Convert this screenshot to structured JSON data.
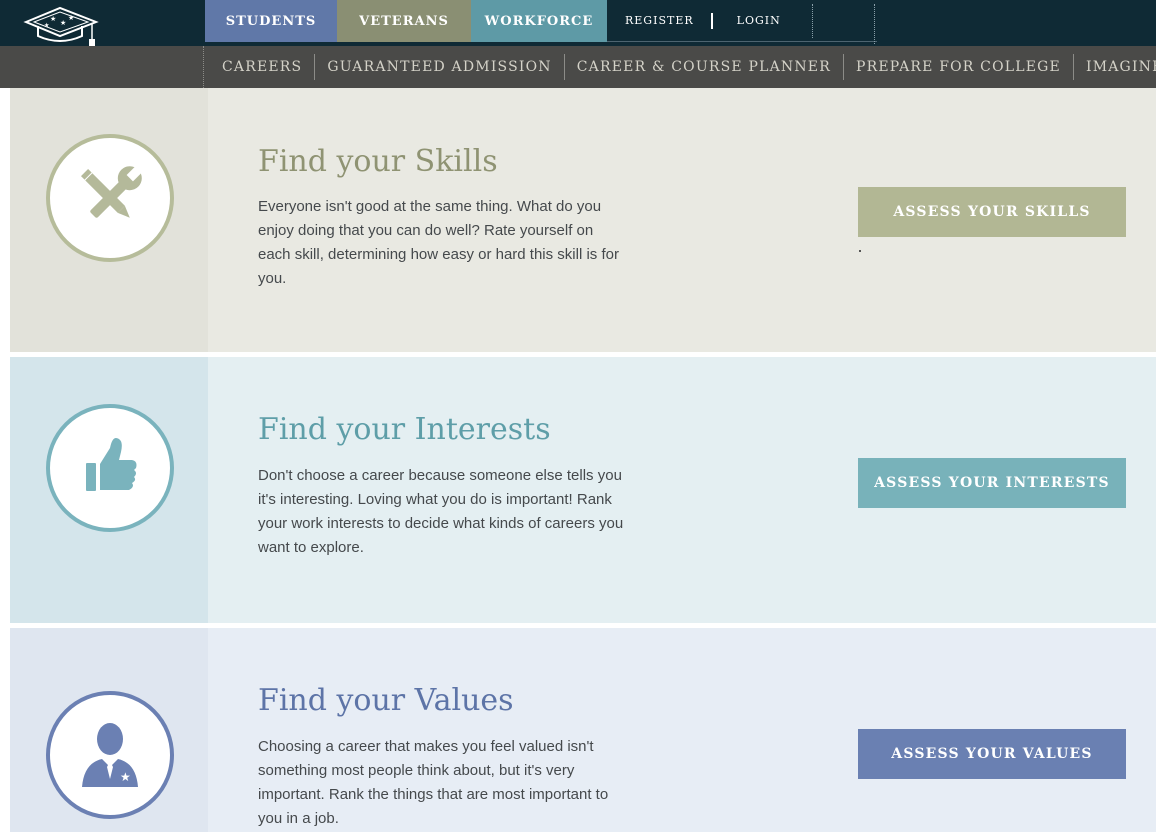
{
  "header": {
    "logo_icon": "graduation-cap-logo-icon",
    "audience_tabs": [
      {
        "label": "STUDENTS",
        "color": "#6078a8"
      },
      {
        "label": "VETERANS",
        "color": "#8a8f73"
      },
      {
        "label": "WORKFORCE",
        "color": "#5e9aa6"
      }
    ],
    "register_label": "REGISTER",
    "login_label": "LOGIN"
  },
  "subnav": {
    "items": [
      "CAREERS",
      "GUARANTEED ADMISSION",
      "CAREER & COURSE PLANNER",
      "PREPARE FOR COLLEGE",
      "IMAGINE"
    ]
  },
  "sections": [
    {
      "icon": "tools-icon",
      "title": "Find your Skills",
      "description": "Everyone isn't good at the same thing. What do you enjoy doing that you can do well? Rate yourself on each skill, determining how easy or hard this skill is for you.",
      "button_label": "ASSESS YOUR SKILLS",
      "accent": "#b2b794"
    },
    {
      "icon": "thumbs-up-icon",
      "title": "Find your Interests",
      "description": "Don't choose a career because someone else tells you it's interesting. Loving what you do is important! Rank your work interests to decide what kinds of careers you want to explore.",
      "button_label": "ASSESS YOUR INTERESTS",
      "accent": "#78b2ba"
    },
    {
      "icon": "person-with-star-icon",
      "title": "Find your Values",
      "description": "Choosing a career that makes you feel valued isn't something most people think about, but it's very important. Rank the things that are most important to you in a job.",
      "button_label": "ASSESS YOUR VALUES",
      "accent": "#6a80b2"
    }
  ]
}
